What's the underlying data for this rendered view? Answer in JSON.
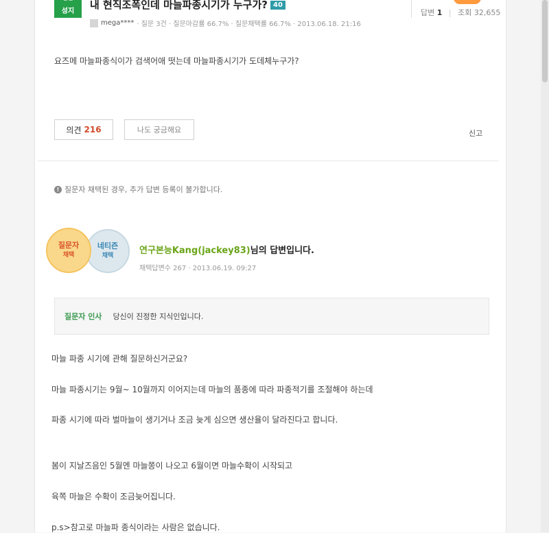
{
  "question": {
    "badge_top": "답변",
    "badge_label": "성지",
    "title": "내 현직조폭인데 마늘파종시기가 누구가?",
    "reward": "40",
    "user": "mega****",
    "meta": "· 질문 3건 · 질문마감률 66.7% · 질문채택률 66.7% · 2013.06.18. 21:16",
    "stats": {
      "answers_label": "답변",
      "answers_value": "1",
      "views_label": "조회",
      "views_value": "32,655"
    },
    "body": "요즈메 마늘파종식이가 검색어애 떳는데 마늘파종시기가 도데체누구가?",
    "opinion_label": "의견",
    "opinion_count": "216",
    "curious_label": "나도 궁금해요",
    "report_label": "신고"
  },
  "notice": "질문자 채택된 경우, 추가 답변 등록이 불가합니다.",
  "answer": {
    "badge_ask_line1": "질문자",
    "badge_ask_line2": "채택",
    "badge_netizen_line1": "네티즌",
    "badge_netizen_line2": "채택",
    "answerer_name": "연구본능Kang(jackey83)",
    "answerer_suffix": "님의 답변입니다.",
    "meta": "채택답변수 267 · 2013.06.19. 09:27",
    "greeting_label": "질문자 인사",
    "greeting_message": "당신이 진정한 지식인입니다.",
    "lines": [
      "마늘 파종 시기에 관해 질문하신거군요?",
      "마늘 파종시기는 9월~ 10월까지 이어지는데 마늘의 품종에 따라 파종적기를 조절해야 하는데",
      "파종 시기에 따라 벌마늘이 생기거나 조금 늦게 심으면 생산율이 달라진다고 합니다.",
      "봄이 지날즈음인 5월엔 마늘쫑이 나오고 6월이면 마늘수확이 시작되고",
      "육쪽 마늘은 수확이 조금늦어집니다.",
      "p.s>참고로 마늘파 종식이라는 사람은 없습니다."
    ]
  },
  "colors": {
    "accent_green": "#27a04a",
    "answerer_green": "#6aa518",
    "opinion_red": "#d14b2a"
  }
}
